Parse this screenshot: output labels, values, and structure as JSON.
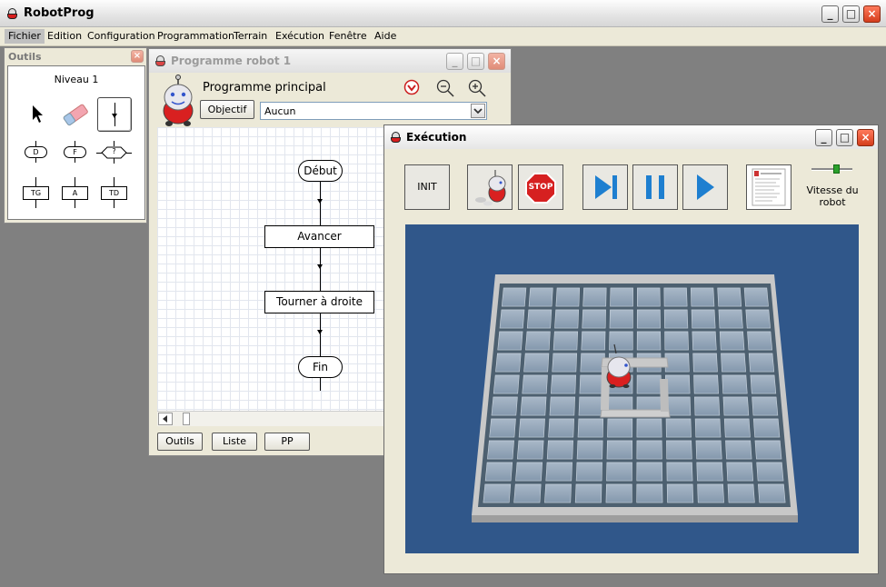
{
  "app": {
    "title": "RobotProg"
  },
  "menu": [
    "Fichier",
    "Edition",
    "Configuration",
    "Programmation",
    "Terrain",
    "Exécution",
    "Fenêtre",
    "Aide"
  ],
  "window_controls": {
    "minimize": "_",
    "maximize": "□",
    "close": "×"
  },
  "outils": {
    "title": "Outils",
    "level": "Niveau 1",
    "nodes": {
      "d": "D",
      "f": "F",
      "q": "?",
      "tg": "TG",
      "a": "A",
      "td": "TD"
    }
  },
  "programme": {
    "title": "Programme robot 1",
    "heading": "Programme principal",
    "objectif_button": "Objectif",
    "objectif_select": "Aucun",
    "flow": [
      "Début",
      "Avancer",
      "Tourner à droite",
      "Fin"
    ],
    "bottom_buttons": [
      "Outils",
      "Liste",
      "PP"
    ]
  },
  "execution": {
    "title": "Exécution",
    "init_button": "INIT",
    "stop_label": "STOP",
    "speed_label": "Vitesse du robot",
    "speed_level": 0.6
  },
  "colors": {
    "accent_blue": "#1e7fd0",
    "stop_red": "#d62020",
    "scene_bg": "#30578a"
  }
}
